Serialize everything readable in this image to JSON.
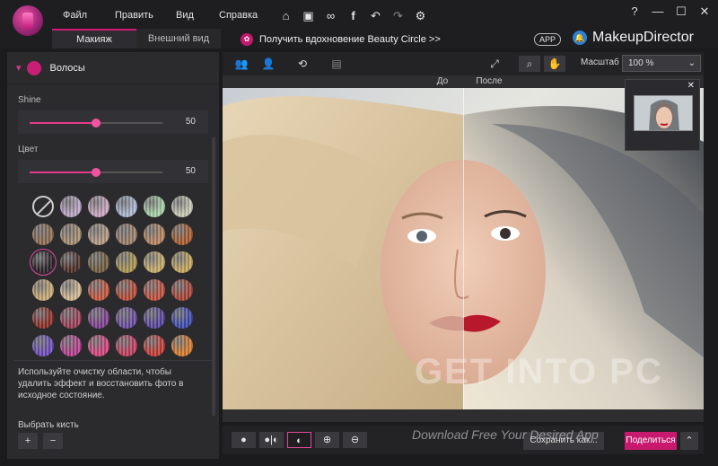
{
  "titlebar": {
    "menu": [
      "Файл",
      "Править",
      "Вид",
      "Справка"
    ],
    "quick_icons": [
      "home-icon",
      "save-icon",
      "share-icon",
      "facebook-icon",
      "undo-icon",
      "redo-icon",
      "settings-icon"
    ],
    "window_buttons": [
      "?",
      "—",
      "☐",
      "✕"
    ]
  },
  "tabs": [
    {
      "label": "Макияж",
      "active": true
    },
    {
      "label": "Внешний вид",
      "active": false
    }
  ],
  "promo": {
    "text": "Получить вдохновение Beauty Circle >>"
  },
  "app_badge": "APP",
  "brand": "MakeupDirector",
  "left_panel": {
    "section_title": "Волосы",
    "sliders": [
      {
        "label": "Shine",
        "value": "50",
        "fraction": 0.5
      },
      {
        "label": "Цвет",
        "value": "50",
        "fraction": 0.5
      }
    ],
    "swatch_rows": [
      [
        "none",
        "#b7a3c2",
        "#c9a5c0",
        "#a8b4cf",
        "#a7d0a6",
        "#c6c7b3"
      ],
      [
        "#8a6a4f",
        "#a48a6d",
        "#b29781",
        "#9a7d69",
        "#b5835e",
        "#a95a2c"
      ],
      [
        "#2a2228",
        "#4a2d26",
        "#6e5b3c",
        "#a89450",
        "#c4aa67",
        "#c6a55c"
      ],
      [
        "#c6a873",
        "#d0b691",
        "#c5553c",
        "#b74a35",
        "#c24e3b",
        "#a94334"
      ],
      [
        "#8c2c24",
        "#9b3c54",
        "#7d3f8e",
        "#6a4a9c",
        "#58439d",
        "#3c49b0"
      ],
      [
        "#6b4bb7",
        "#b43c8c",
        "#d4417b",
        "#c23c5e",
        "#c63a33",
        "#d67a2a"
      ]
    ],
    "selected_swatch": "2-0",
    "hint": "Используйте очистку области, чтобы удалить эффект и восстановить фото в исходное состояние.",
    "brush_label": "Выбрать кисть",
    "brush_buttons": [
      "+",
      "−"
    ]
  },
  "toolbar": {
    "zoom_label": "Масштаб :",
    "zoom_value": "100 %"
  },
  "compare": {
    "before": "До",
    "after": "После"
  },
  "bottombar": {
    "save_label": "Сохранить как...",
    "share_label": "Поделиться"
  },
  "watermark": {
    "main": "GET INTO PC",
    "sub": "Download Free Your Desired App"
  }
}
